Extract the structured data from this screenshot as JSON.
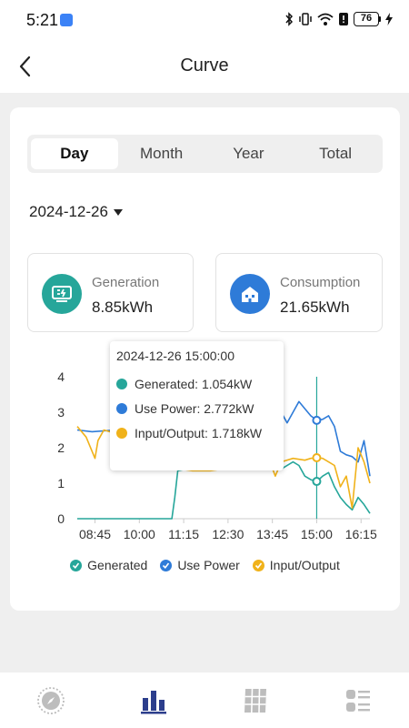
{
  "status_bar": {
    "time": "5:21",
    "battery": "76"
  },
  "header": {
    "title": "Curve"
  },
  "tabs": [
    {
      "label": "Day",
      "active": true
    },
    {
      "label": "Month",
      "active": false
    },
    {
      "label": "Year",
      "active": false
    },
    {
      "label": "Total",
      "active": false
    }
  ],
  "date": "2024-12-26",
  "stats": {
    "generation": {
      "label": "Generation",
      "value": "8.85kWh",
      "color": "#26a69a"
    },
    "consumption": {
      "label": "Consumption",
      "value": "21.65kWh",
      "color": "#2e7bd8"
    }
  },
  "tooltip": {
    "title": "2024-12-26 15:00:00",
    "rows": [
      {
        "text": "Generated: 1.054kW",
        "color": "#26a69a"
      },
      {
        "text": "Use Power: 2.772kW",
        "color": "#2e7bd8"
      },
      {
        "text": "Input/Output: 1.718kW",
        "color": "#f0b21a"
      }
    ]
  },
  "legend": [
    {
      "label": "Generated",
      "color": "#26a69a"
    },
    {
      "label": "Use Power",
      "color": "#2e7bd8"
    },
    {
      "label": "Input/Output",
      "color": "#f0b21a"
    }
  ],
  "chart_data": {
    "type": "line",
    "x_tick_labels": [
      "08:45",
      "10:00",
      "11:15",
      "12:30",
      "13:45",
      "15:00",
      "16:15"
    ],
    "x_ticks_min": [
      525,
      600,
      675,
      750,
      825,
      900,
      975
    ],
    "xlim_min": [
      495,
      990
    ],
    "ylim": [
      0,
      4
    ],
    "y_ticks": [
      0,
      1,
      2,
      3,
      4
    ],
    "y_tick_labels": [
      "0",
      "1",
      "2",
      "3",
      "4"
    ],
    "grid": false,
    "cursor_x_min": 900,
    "series": [
      {
        "name": "Generated",
        "color": "#26a69a",
        "x": [
          495,
          520,
          560,
          600,
          640,
          655,
          660,
          665,
          680,
          700,
          720,
          740,
          760,
          780,
          800,
          820,
          840,
          860,
          870,
          880,
          890,
          900,
          910,
          920,
          930,
          940,
          950,
          960,
          970,
          980,
          990
        ],
        "y": [
          0,
          0,
          0,
          0,
          0,
          0,
          0.6,
          1.35,
          1.4,
          1.38,
          1.42,
          1.4,
          1.4,
          1.45,
          1.5,
          1.55,
          1.4,
          1.6,
          1.5,
          1.2,
          1.1,
          1.05,
          1.2,
          1.3,
          0.9,
          0.6,
          0.4,
          0.25,
          0.6,
          0.4,
          0.15
        ]
      },
      {
        "name": "Use Power",
        "color": "#2e7bd8",
        "x": [
          495,
          520,
          560,
          600,
          640,
          660,
          670,
          690,
          720,
          750,
          780,
          800,
          820,
          830,
          840,
          850,
          860,
          870,
          880,
          890,
          900,
          910,
          920,
          930,
          940,
          950,
          960,
          970,
          980,
          990
        ],
        "y": [
          2.5,
          2.45,
          2.5,
          2.4,
          2.5,
          2.6,
          2.4,
          2.5,
          2.6,
          2.5,
          2.6,
          2.7,
          3.3,
          2.6,
          3.0,
          2.7,
          3.0,
          3.3,
          3.1,
          2.9,
          2.772,
          2.8,
          2.9,
          2.6,
          1.9,
          1.8,
          1.75,
          1.6,
          2.2,
          1.2
        ]
      },
      {
        "name": "Input/Output",
        "color": "#f0b21a",
        "x": [
          495,
          510,
          525,
          530,
          540,
          560,
          600,
          640,
          655,
          660,
          670,
          690,
          720,
          740,
          760,
          780,
          800,
          820,
          830,
          840,
          860,
          880,
          890,
          900,
          910,
          920,
          930,
          940,
          950,
          960,
          970,
          980,
          990
        ],
        "y": [
          2.6,
          2.3,
          1.7,
          2.2,
          2.5,
          2.4,
          2.5,
          2.3,
          2.5,
          1.4,
          1.4,
          1.35,
          1.35,
          1.4,
          1.5,
          1.4,
          1.6,
          1.65,
          1.2,
          1.6,
          1.7,
          1.65,
          1.7,
          1.718,
          1.7,
          1.6,
          1.5,
          0.9,
          1.2,
          0.3,
          2.0,
          1.6,
          1.0
        ]
      }
    ]
  },
  "nav": [
    {
      "icon": "compass-icon",
      "active": false
    },
    {
      "icon": "bar-chart-icon",
      "active": true
    },
    {
      "icon": "solar-panel-icon",
      "active": false
    },
    {
      "icon": "menu-list-icon",
      "active": false
    }
  ],
  "colors": {
    "accent": "#2c3e8c",
    "inactive_nav": "#bdbdbd",
    "cursor": "#26a69a"
  }
}
